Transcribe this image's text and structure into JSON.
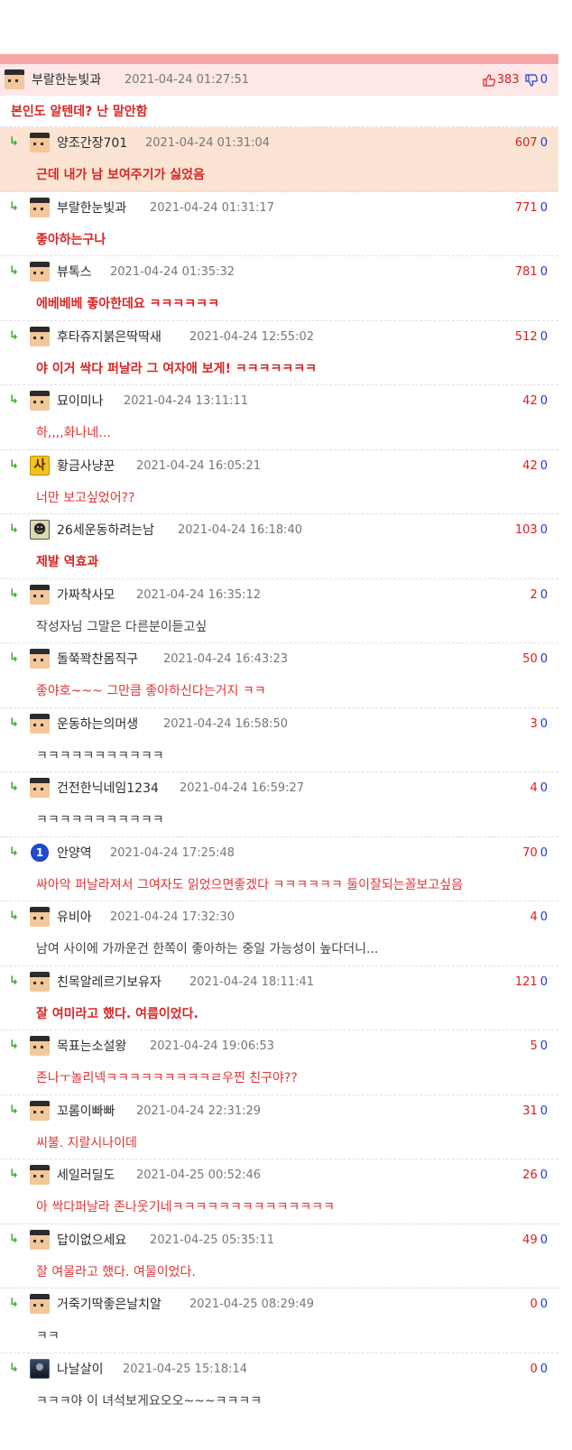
{
  "best": {
    "nick": "부랄한눈빛과",
    "date": "2021-04-24 01:27:51",
    "up": "383",
    "down": "0",
    "text": "본인도 알텐데? 난 말안함"
  },
  "replies": [
    {
      "nick": "양조간장701",
      "date": "2021-04-24 01:31:04",
      "up": "607",
      "down": "0",
      "text": "근데 내가 남 보여주기가 싫었음"
    },
    {
      "nick": "부랄한눈빛과",
      "date": "2021-04-24 01:31:17",
      "up": "771",
      "down": "0",
      "text": "좋아하는구나"
    },
    {
      "nick": "뷰톡스",
      "date": "2021-04-24 01:35:32",
      "up": "781",
      "down": "0",
      "text": "에베베베 좋아한데요 ㅋㅋㅋㅋㅋㅋ"
    },
    {
      "nick": "후타쥬지붉은딱딱새",
      "date": "2021-04-24 12:55:02",
      "up": "512",
      "down": "0",
      "text": "야 이거 싹다 퍼날라 그 여자애 보게! ㅋㅋㅋㅋㅋㅋㅋ"
    },
    {
      "nick": "묘이미나",
      "date": "2021-04-24 13:11:11",
      "up": "42",
      "down": "0",
      "text": "하,,,,화나네..."
    },
    {
      "nick": "황금사냥꾼",
      "date": "2021-04-24 16:05:21",
      "up": "42",
      "down": "0",
      "text": "너만 보고싶었어??"
    },
    {
      "nick": "26세운동하려는남",
      "date": "2021-04-24 16:18:40",
      "up": "103",
      "down": "0",
      "text": "제발 역효과"
    },
    {
      "nick": "가짜착사모",
      "date": "2021-04-24 16:35:12",
      "up": "2",
      "down": "0",
      "text": "작성자님 그말은 다른분이듣고싶"
    },
    {
      "nick": "돌쭉꽉찬몸직구",
      "date": "2021-04-24 16:43:23",
      "up": "50",
      "down": "0",
      "text": "좋야호~~~ 그만큼 좋아하신다는거지 ㅋㅋ"
    },
    {
      "nick": "운동하는의머생",
      "date": "2021-04-24 16:58:50",
      "up": "3",
      "down": "0",
      "text": "ㅋㅋㅋㅋㅋㅋㅋㅋㅋㅋㅋ"
    },
    {
      "nick": "건전한닉네임1234",
      "date": "2021-04-24 16:59:27",
      "up": "4",
      "down": "0",
      "text": "ㅋㅋㅋㅋㅋㅋㅋㅋㅋㅋㅋ"
    },
    {
      "nick": "안양역",
      "date": "2021-04-24 17:25:48",
      "up": "70",
      "down": "0",
      "text": "싸아악 퍼날라져서 그여자도 읽었으면좋겠다 ㅋㅋㅋㅋㅋㅋ 둘이잘되는꼴보고싶음"
    },
    {
      "nick": "유비아",
      "date": "2021-04-24 17:32:30",
      "up": "4",
      "down": "0",
      "text": "남여 사이에 가까운건 한쪽이 좋아하는 중일 가능성이 높다더니..."
    },
    {
      "nick": "친목알레르기보유자",
      "date": "2021-04-24 18:11:41",
      "up": "121",
      "down": "0",
      "text": "잘 여미라고 했다. 여름이었다."
    },
    {
      "nick": "목표는소설왕",
      "date": "2021-04-24 19:06:53",
      "up": "5",
      "down": "0",
      "text": "존나ㅜ놀리넥ㅋㅋㅋㅋㅋㅋㅋㅋㅋㄹ우찐 친구야??"
    },
    {
      "nick": "꼬롬이빠빠",
      "date": "2021-04-24 22:31:29",
      "up": "31",
      "down": "0",
      "text": "씨불. 지랄시나이데"
    },
    {
      "nick": "세일러딜도",
      "date": "2021-04-25 00:52:46",
      "up": "26",
      "down": "0",
      "text": "아 싹다퍼날라 존나웃기네ㅋㅋㅋㅋㅋㅋㅋㅋㅋㅋㅋㅋㅋㅋ"
    },
    {
      "nick": "답이없으세요",
      "date": "2021-04-25 05:35:11",
      "up": "49",
      "down": "0",
      "text": "잘 여물라고 했다. 여물이었다."
    },
    {
      "nick": "거죽기딱좋은날치알",
      "date": "2021-04-25 08:29:49",
      "up": "0",
      "down": "0",
      "text": "ㅋㅋ"
    },
    {
      "nick": "나날살이",
      "date": "2021-04-25 15:18:14",
      "up": "0",
      "down": "0",
      "text": "ㅋㅋㅋ야 이 녀석보게요오오~~~ㅋㅋㅋㅋ"
    }
  ]
}
